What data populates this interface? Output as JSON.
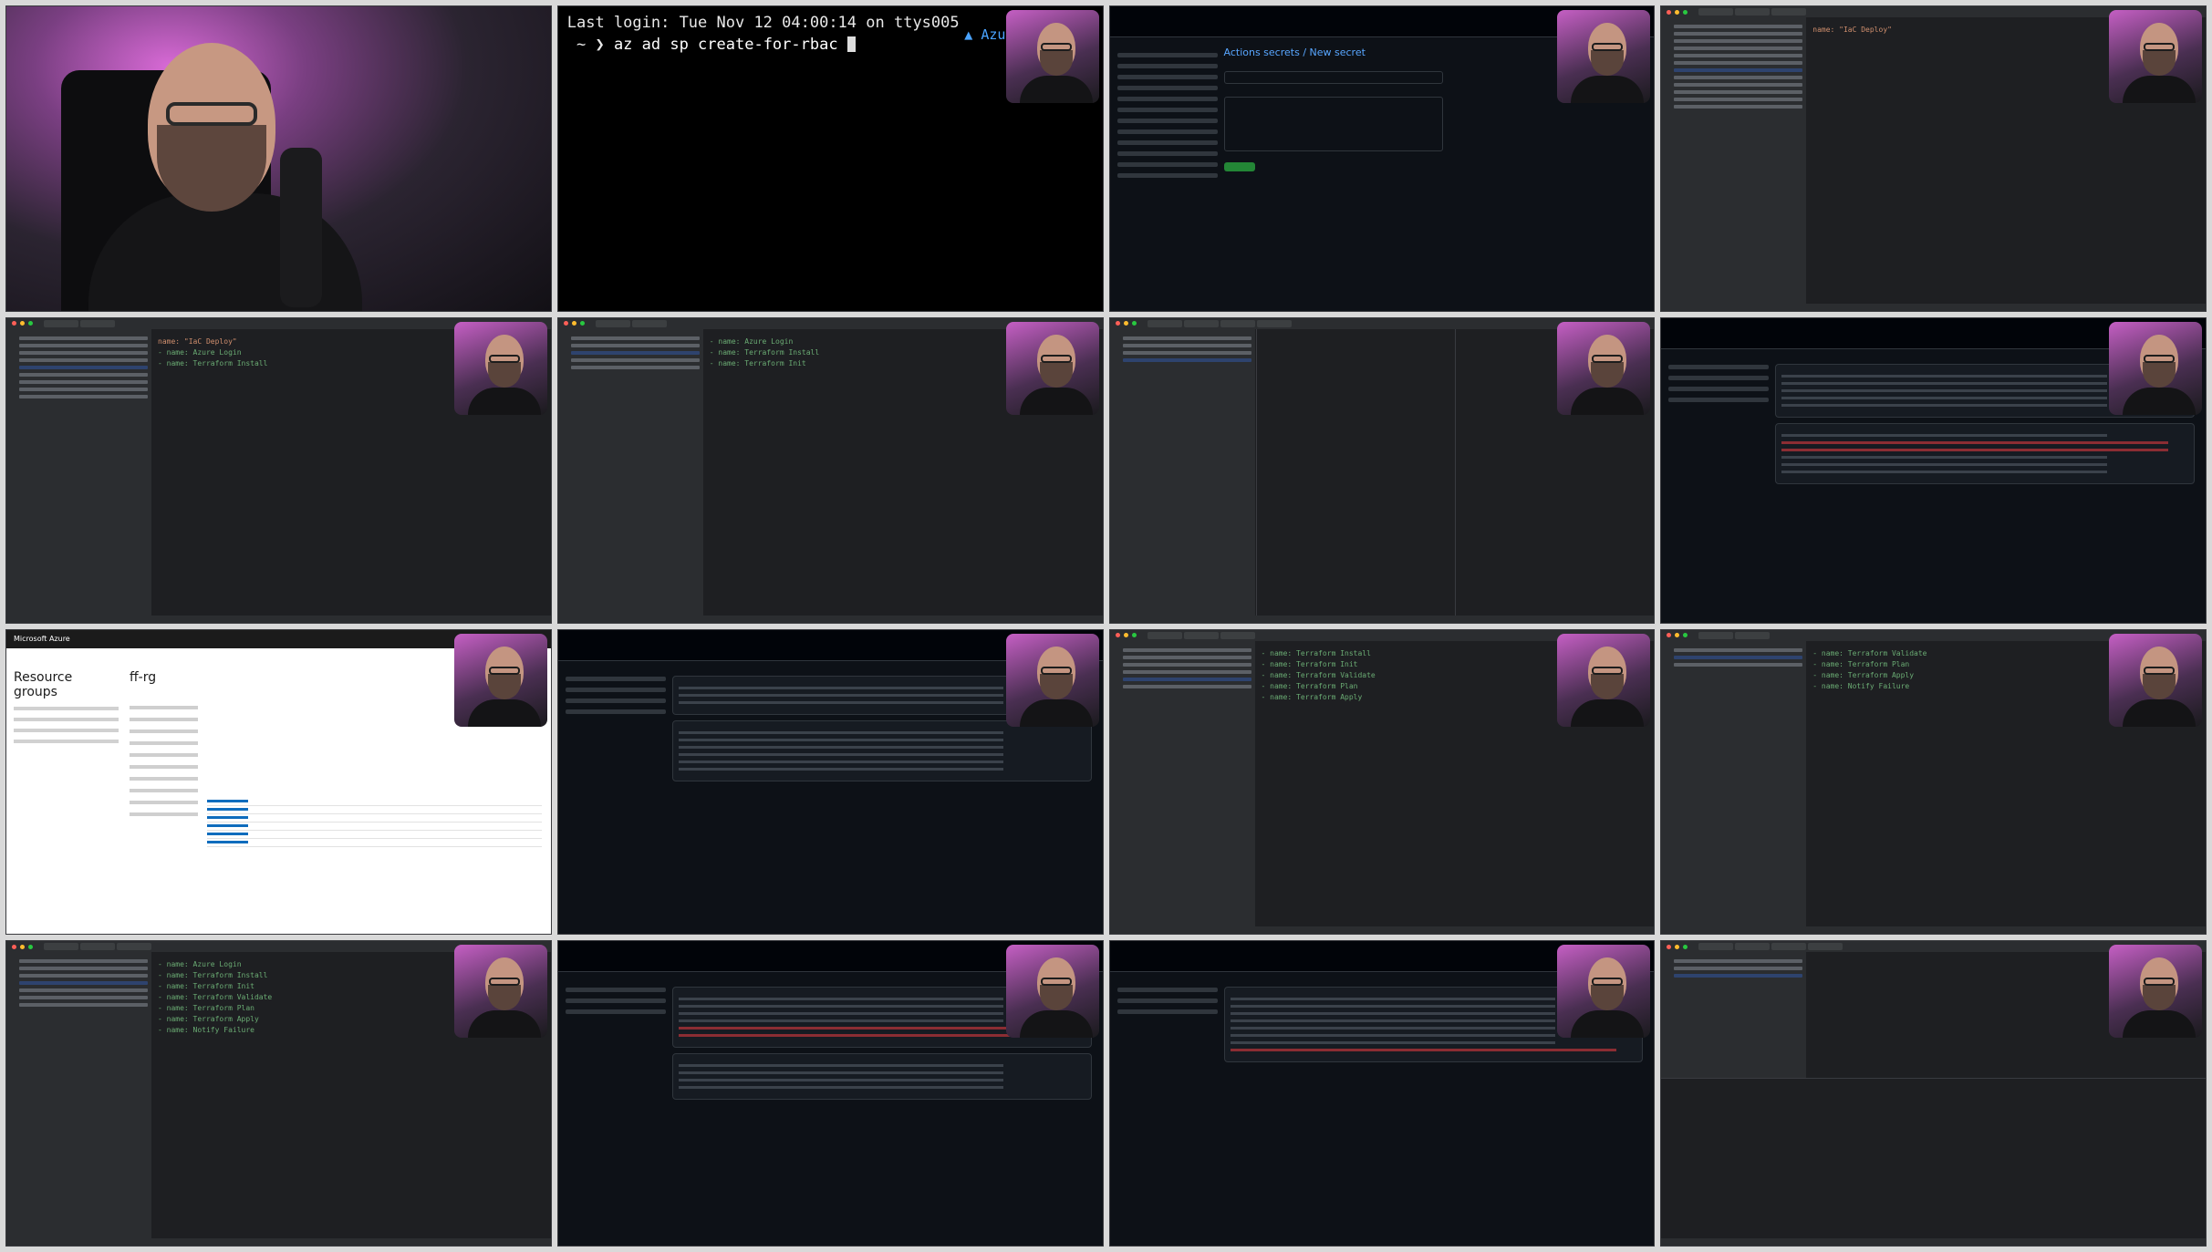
{
  "terminal": {
    "last_login": "Last login: Tue Nov 12 04:00:14 on ttys005",
    "prompt": " ~ ❯ ",
    "command": "az ad sp create-for-rbac ",
    "context": "Azure"
  },
  "github_secret": {
    "title": "Actions secrets / New secret"
  },
  "azure": {
    "brand": "Microsoft Azure",
    "page_title": "Resource groups",
    "resource_group": "ff-rg"
  },
  "ide_snippets": {
    "name_line": "name: \"IaC Deploy\"",
    "azure_login": "- name: Azure Login",
    "tf_install": "- name: Terraform Install",
    "tf_init": "- name: Terraform Init",
    "tf_validate": "- name: Terraform Validate",
    "tf_plan": "- name: Terraform Plan",
    "tf_apply": "- name: Terraform Apply",
    "notify": "- name: Notify Failure"
  },
  "colors": {
    "terminal_bg": "#000000",
    "ide_bg": "#1e1f22",
    "github_bg": "#0d1117",
    "azure_accent": "#0f6cbd"
  }
}
